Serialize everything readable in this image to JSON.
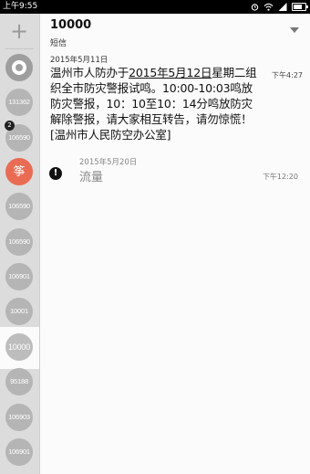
{
  "status_bar": {
    "time": "上午9:55"
  },
  "header": {
    "title": "10000",
    "subtitle": "短信"
  },
  "sidebar": {
    "add_label": "+",
    "contacts": [
      {
        "label": "131362"
      },
      {
        "label": "106590",
        "badge": "2"
      },
      {
        "label": "筝"
      },
      {
        "label": "106590"
      },
      {
        "label": "106590"
      },
      {
        "label": "106901"
      },
      {
        "label": "10001"
      },
      {
        "label": "10000"
      },
      {
        "label": "95188"
      },
      {
        "label": "106903"
      },
      {
        "label": "106901"
      }
    ]
  },
  "messages": [
    {
      "date": "2015年5月11日",
      "text_parts": [
        "温州市人防办于",
        "2015年5月12日",
        "星期二组织全市防灾警报试鸣。10:00-10:03鸣放防灾警报，10：10至10：14分鸣放防灾解除警报，请大家相互转告，请勿惊慌！[温州市人民防空办公室]"
      ],
      "time": "下午4:27"
    },
    {
      "date": "2015年5月20日",
      "text": "流量",
      "time": "下午12:20",
      "alert_icon": "!"
    }
  ]
}
